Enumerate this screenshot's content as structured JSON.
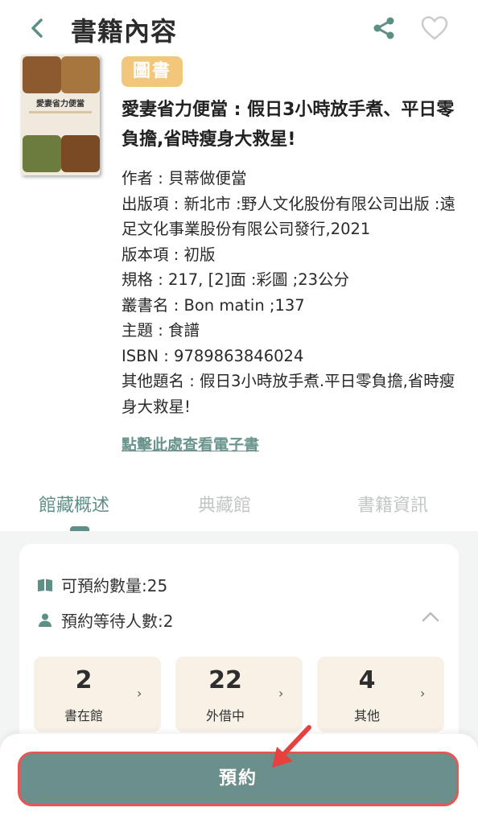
{
  "header": {
    "title": "書籍內容",
    "back_icon": "chevron-left-icon",
    "share_icon": "share-icon",
    "favorite_icon": "heart-icon"
  },
  "book": {
    "badge": "圖書",
    "title": "愛妻省力便當 : 假日3小時放手煮、平日零負擔,省時瘦身大救星!",
    "meta": [
      "作者 : 貝蒂做便當",
      "出版項 : 新北市 :野人文化股份有限公司出版 :遠足文化事業股份有限公司發行,2021",
      "版本項 : 初版",
      "規格 : 217, [2]面 :彩圖 ;23公分",
      "叢書名 : Bon matin ;137",
      "主題 : 食譜",
      "ISBN : 9789863846024",
      "其他題名 : 假日3小時放手煮.平日零負擔,省時瘦身大救星!"
    ],
    "ebook_link": "點擊此處查看電子書",
    "cover_text": "愛妻省力便當"
  },
  "tabs": [
    {
      "label": "館藏概述",
      "active": true
    },
    {
      "label": "典藏館",
      "active": false
    },
    {
      "label": "書籍資訊",
      "active": false
    }
  ],
  "summary": {
    "available_label": "可預約數量:25",
    "waiting_label": "預約等待人數:2",
    "boxes": [
      {
        "value": "2",
        "label": "書在館"
      },
      {
        "value": "22",
        "label": "外借中"
      },
      {
        "value": "4",
        "label": "其他"
      }
    ]
  },
  "action": {
    "reserve_label": "預約"
  },
  "colors": {
    "accent": "#5e8f87",
    "badge": "#f2c77c",
    "button": "#6b8f8a",
    "highlight": "#e85555"
  }
}
